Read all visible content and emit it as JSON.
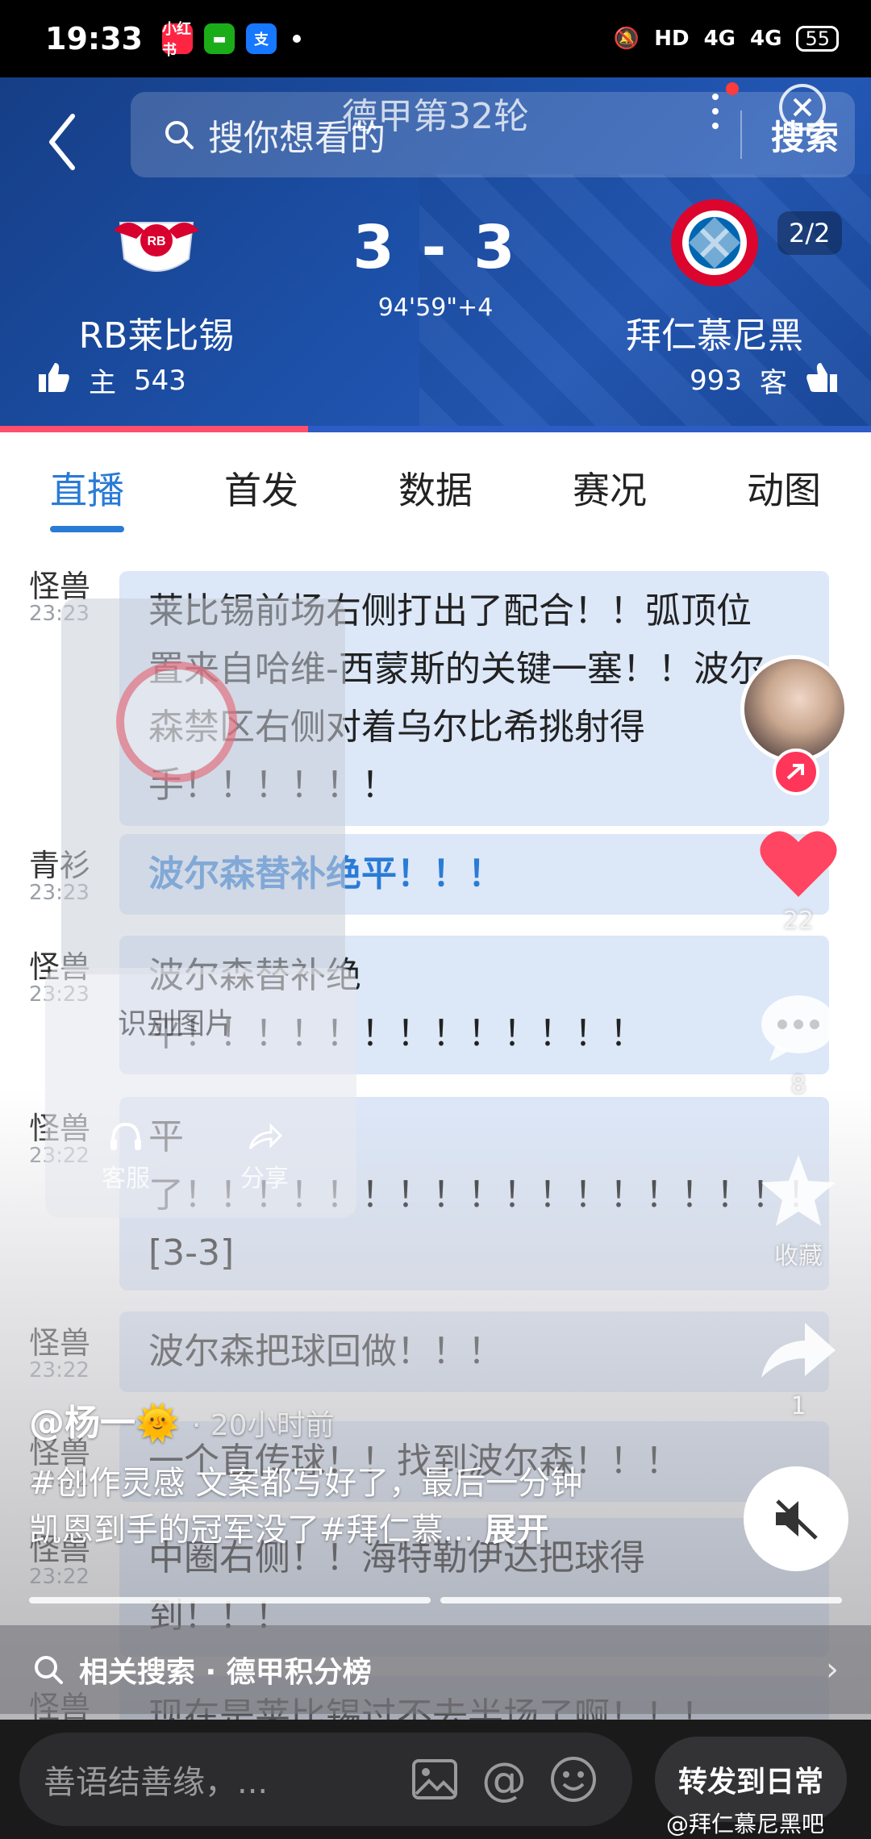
{
  "status_bar": {
    "time": "19:33",
    "apps": [
      "小红书",
      "消息",
      "支"
    ],
    "right": [
      "HD",
      "4G",
      "4G"
    ],
    "battery": "55"
  },
  "header": {
    "round_title": "德甲第32轮",
    "search_placeholder": "搜你想看的",
    "search_button": "搜索",
    "page_indicator": "2/2"
  },
  "match": {
    "home_team": "RB莱比锡",
    "away_team": "拜仁慕尼黑",
    "score": "3 - 3",
    "clock": "94'59\"+4",
    "home_label": "主",
    "home_likes": "543",
    "away_label": "客",
    "away_likes": "993",
    "home_support_fraction": 0.354,
    "colors": {
      "home": "#ff4f6d",
      "away": "#2d5cc4",
      "header": "#1c4fa6"
    }
  },
  "tabs": [
    "直播",
    "首发",
    "数据",
    "赛况",
    "动图"
  ],
  "feed": [
    {
      "author": "怪兽",
      "time": "23:23",
      "text": "莱比锡前场右侧打出了配合！！弧顶位\n置来自哈维-西蒙斯的关键一塞！！波尔\n森禁区右侧对着乌尔比希挑射得\n手！！！！！！",
      "highlight": false
    },
    {
      "author": "青衫",
      "time": "23:23",
      "text": "波尔森替补绝平！！！",
      "highlight": true
    },
    {
      "author": "怪兽",
      "time": "23:23",
      "text": "波尔森替补绝\n平！！！！！！！！！！！！！",
      "highlight": false
    },
    {
      "author": "怪兽",
      "time": "23:22",
      "text": "平\n了！！！！！！！！！！！！！！！！！！！！\n[3-3]",
      "highlight": false
    },
    {
      "author": "怪兽",
      "time": "23:22",
      "text": "波尔森把球回做！！！",
      "highlight": false
    },
    {
      "author": "怪兽",
      "time": "23:22",
      "text": "一个直传球！！找到波尔森！！！",
      "highlight": false
    },
    {
      "author": "怪兽",
      "time": "23:22",
      "text": "中圈右侧！！海特勒伊达把球得\n到！！！",
      "highlight": false
    },
    {
      "author": "怪兽",
      "time": "",
      "text": "现在是莱比锡过不去半场了啊！！！",
      "highlight": false
    }
  ],
  "overlay": {
    "recognize": "识别图片",
    "service": "客服",
    "share": "分享",
    "likes": "22",
    "comments": "8",
    "favorite_label": "收藏",
    "shares": "1",
    "user": "@杨一🌞",
    "ago": "· 20小时前",
    "desc": "#创作灵感 文案都写好了，最后一分钟\n凯恩到手的冠军没了#拜仁慕...",
    "expand": "展开",
    "related_label": "相关搜索 · 德甲积分榜"
  },
  "bottom": {
    "comment_placeholder": "善语结善缘，...",
    "forward_button": "转发到日常",
    "watermark": "@拜仁慕尼黑吧"
  }
}
